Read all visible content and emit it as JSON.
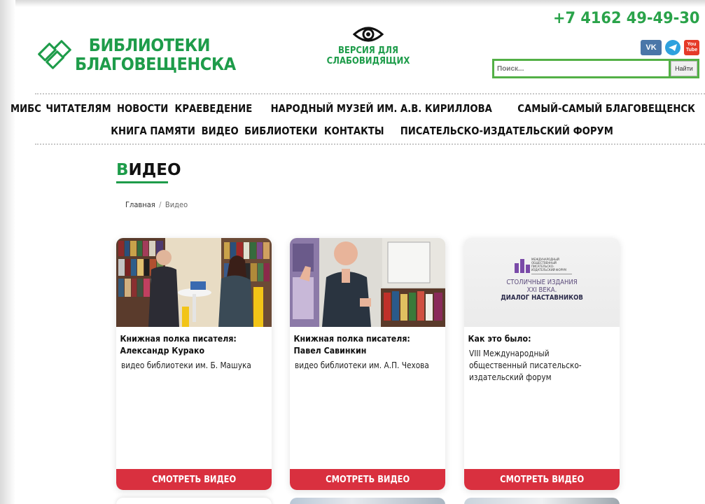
{
  "header": {
    "logo_line1": "БИБЛИОТЕКИ",
    "logo_line2": "БЛАГОВЕЩЕНСКА",
    "low_vision_line1": "ВЕРСИЯ ДЛЯ",
    "low_vision_line2": "СЛАБОВИДЯЩИХ",
    "phone": "+7 4162 49-49-30",
    "socials": [
      {
        "icon": "vk-icon",
        "label": "VK"
      },
      {
        "icon": "telegram-icon",
        "label": ""
      },
      {
        "icon": "youtube-icon",
        "label_top": "You",
        "label_bottom": "Tube"
      }
    ],
    "search": {
      "placeholder": "Поиск...",
      "button_label": "Найти"
    },
    "brand_color": "#1e9c4a"
  },
  "nav": {
    "row1": [
      "МИБС",
      "ЧИТАТЕЛЯМ",
      "НОВОСТИ",
      "КРАЕВЕДЕНИЕ",
      "НАРОДНЫЙ МУЗЕЙ ИМ. А.В. КИРИЛЛОВА",
      "САМЫЙ-САМЫЙ БЛАГОВЕЩЕНСК"
    ],
    "row2": [
      "КНИГА ПАМЯТИ",
      "ВИДЕО",
      "БИБЛИОТЕКИ",
      "КОНТАКТЫ",
      "ПИСАТЕЛЬСКО-ИЗДАТЕЛЬСКИЙ ФОРУМ"
    ]
  },
  "main": {
    "title_first": "В",
    "title_rest": "ИДЕО",
    "breadcrumb": {
      "home": "Главная",
      "separator": "/",
      "current": "Видео"
    },
    "cards": [
      {
        "title": "Книжная полка писателя: Александр Курако",
        "description": "видео библиотеки им. Б. Машука",
        "button": "СМОТРЕТЬ ВИДЕО"
      },
      {
        "title": "Книжная полка писателя: Павел Савинкин",
        "description": "видео библиотеки им. А.П. Чехова",
        "button": "СМОТРЕТЬ ВИДЕО"
      },
      {
        "title": "Как это было:",
        "description": "VIII Международный общественный писательско-издательский форум",
        "button": "СМОТРЕТЬ ВИДЕО",
        "thumb_text": {
          "small": "МЕЖДУНАРОДНЫЙ ОБЩЕСТВЕННЫЙ ПИСАТЕЛЬСКО-ИЗДАТЕЛЬСКИЙ ФОРУМ",
          "line1": "СТОЛИЧНЫЕ ИЗДАНИЯ",
          "line2": "XXI ВЕКА.",
          "line3": "ДИАЛОГ НАСТАВНИКОВ"
        }
      }
    ],
    "button_color": "#d9303f"
  }
}
